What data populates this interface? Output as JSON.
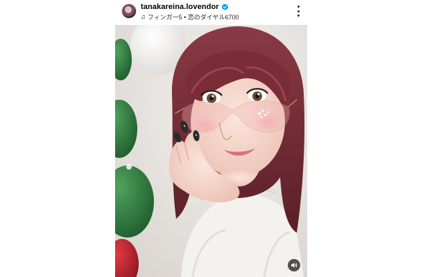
{
  "post": {
    "username": "tanakareina.lovendor",
    "verified": true,
    "audio": {
      "track": "フィンガー5 • 恋のダイヤル6700",
      "icon": "music-note-icon"
    },
    "actions": {
      "more_icon": "more-vertical-icon",
      "mute_icon": "speaker-icon"
    }
  },
  "colors": {
    "verified_badge": "#0095f6",
    "balloon_green": "#2f7a3f",
    "balloon_red": "#b0202a",
    "hair": "#6e2b32",
    "sweater": "#f4f2ef"
  }
}
